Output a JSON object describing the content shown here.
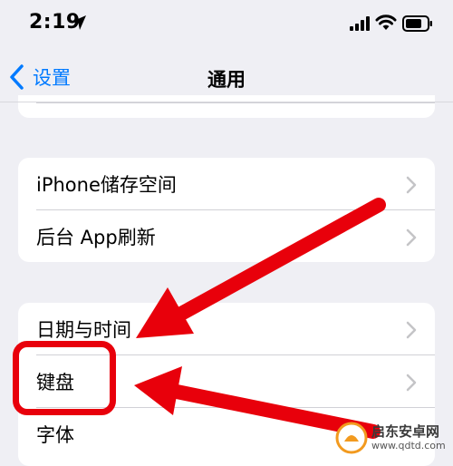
{
  "status_bar": {
    "time": "2:19",
    "icons": [
      "location-arrow-icon",
      "cellular-signal-icon",
      "wifi-icon",
      "battery-icon"
    ]
  },
  "nav_bar": {
    "back_label": "设置",
    "title": "通用"
  },
  "groups": [
    {
      "rows": [
        {
          "label": "iPhone储存空间"
        },
        {
          "label": "后台 App刷新"
        }
      ]
    },
    {
      "rows": [
        {
          "label": "日期与时间"
        },
        {
          "label": "键盘"
        },
        {
          "label": "字体"
        }
      ]
    }
  ],
  "annotation": {
    "color": "#e8000b",
    "highlighted_row": "键盘"
  },
  "watermark": {
    "title": "启东安卓网",
    "url": "www.qdtd.com"
  },
  "colors": {
    "accent": "#007aff",
    "background": "#efeff4",
    "chevron": "#c4c4c7"
  }
}
